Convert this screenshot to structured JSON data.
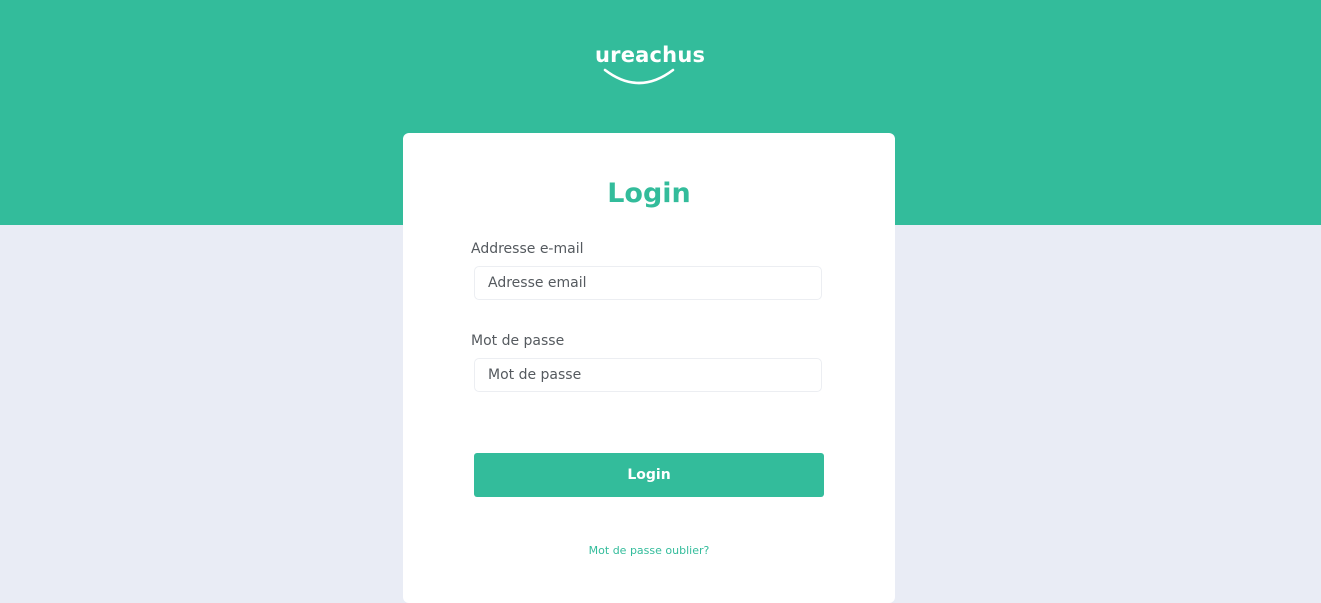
{
  "brand": {
    "name": "ureachus",
    "logo_icon": "smile-arc-icon"
  },
  "colors": {
    "accent": "#33bc9b",
    "background": "#e9ecf5",
    "card": "#ffffff",
    "text": "#555a5f"
  },
  "login_form": {
    "title": "Login",
    "email": {
      "label": "Addresse e-mail",
      "placeholder": "Adresse email",
      "value": ""
    },
    "password": {
      "label": "Mot de passe",
      "placeholder": "Mot de passe",
      "value": ""
    },
    "submit_label": "Login",
    "forgot_password_label": "Mot de passe oublier?"
  }
}
